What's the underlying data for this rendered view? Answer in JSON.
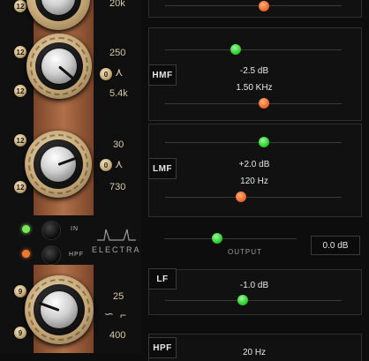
{
  "top": {
    "freq_label": "20k"
  },
  "hmf": {
    "left_label": "12",
    "right_label": "12",
    "bottom_left": "12",
    "center_label": "0",
    "freq_top": "250",
    "freq_bottom": "5.4k"
  },
  "lmf": {
    "left_label": "12",
    "right_label": "12",
    "bottom_left": "12",
    "center_label": "0",
    "freq_top": "30",
    "freq_bottom": "730"
  },
  "lf": {
    "left_label": "9",
    "bottom_left": "9",
    "freq_top": "25",
    "freq_bottom": "400"
  },
  "switches": {
    "in_label": "IN",
    "hpf_label": "HPF",
    "in_led": "#7be85a",
    "hpf_led": "#f07830"
  },
  "brand": {
    "logo_text": "ELECTRA"
  },
  "bands": [
    {
      "tag": "HMF",
      "gain": "-2.5 dB",
      "freq": "1.50 KHz"
    },
    {
      "tag": "LMF",
      "gain": "+2.0 dB",
      "freq": "120 Hz"
    }
  ],
  "output": {
    "label": "OUTPUT",
    "value": "0.0 dB"
  },
  "lf_band": {
    "tag": "LF",
    "gain": "-1.0 dB"
  },
  "hpf_band": {
    "tag": "HPF",
    "freq": "20 Hz"
  },
  "colors": {
    "accent_green": "#2ed32e",
    "accent_orange": "#f26a2e",
    "copper": "#a8684a"
  },
  "sliders": {
    "top_freq_fraction": 0.56,
    "hmf_gain_fraction": 0.4,
    "hmf_freq_fraction": 0.56,
    "lmf_gain_fraction": 0.56,
    "lmf_freq_fraction": 0.43,
    "output_fraction": 0.4,
    "lf_gain_fraction": 0.44
  }
}
